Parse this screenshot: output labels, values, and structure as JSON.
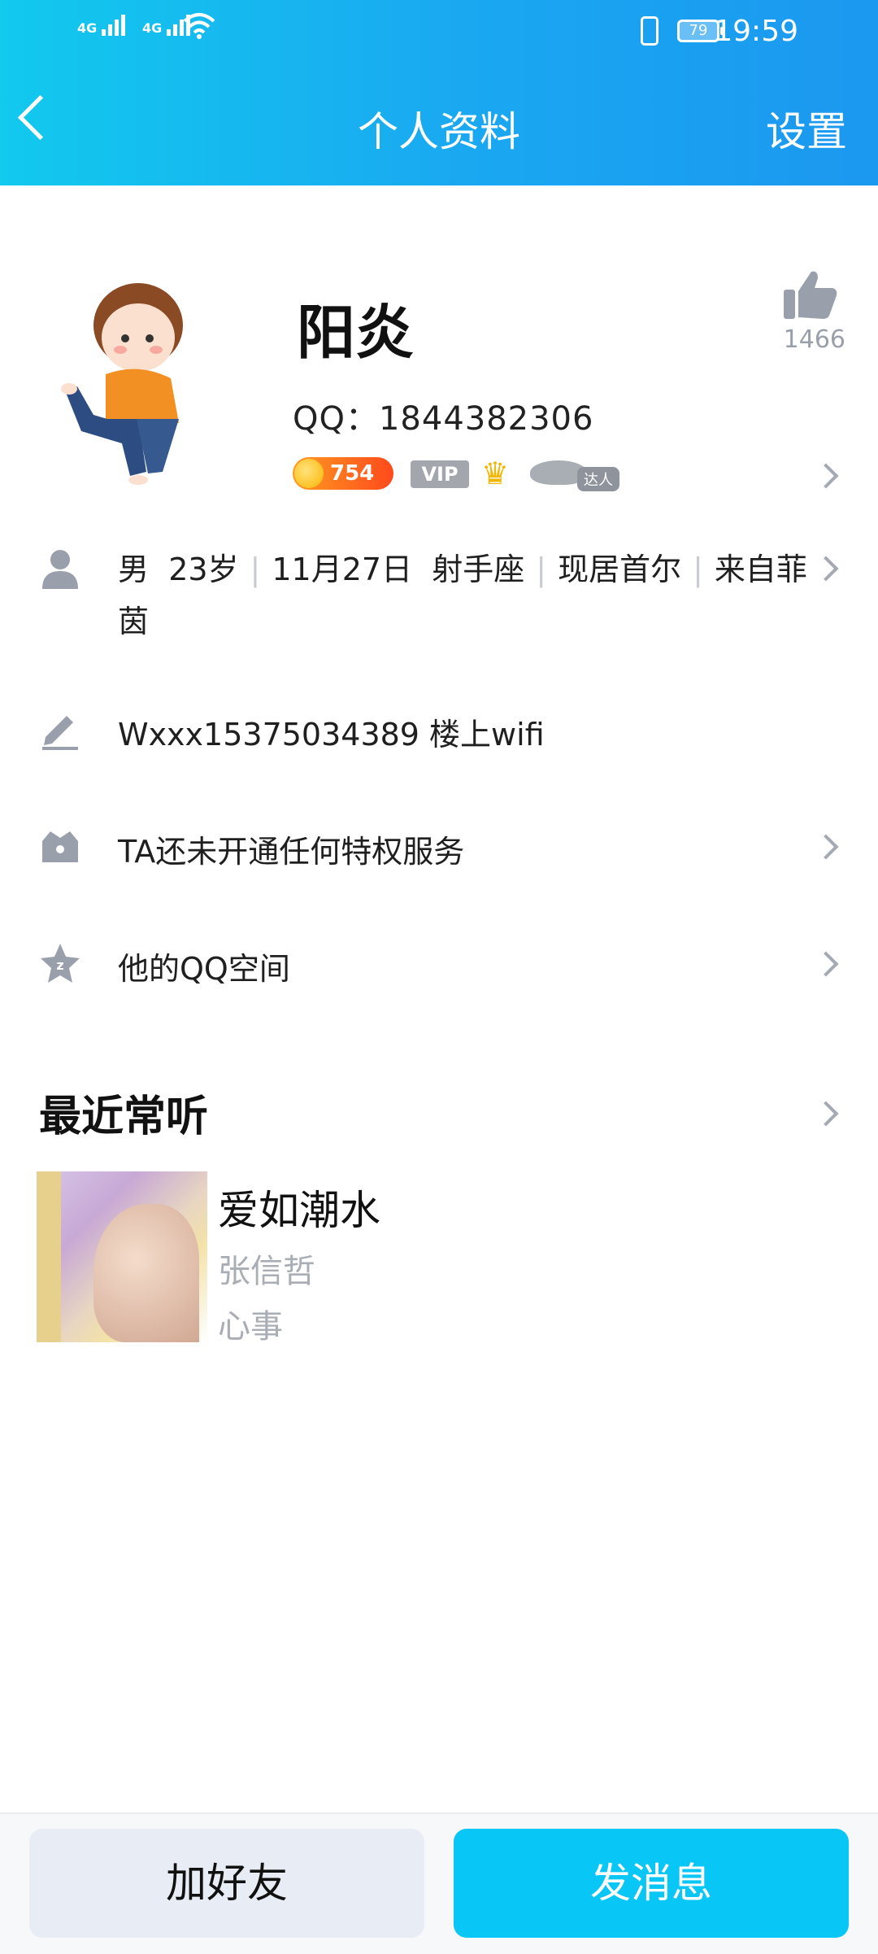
{
  "status_bar": {
    "net1": "4G",
    "net2": "4G",
    "battery": "79",
    "time": "19:59"
  },
  "header": {
    "back_icon": "chevron-left-icon",
    "title": "个人资料",
    "settings_label": "设置"
  },
  "profile": {
    "name": "阳炎",
    "qq": "QQ：1844382306",
    "likes": "1466",
    "coin_level": "754",
    "vip_label": "VIP",
    "daren_label": "达人"
  },
  "info": {
    "gender": "男",
    "age": "23岁",
    "birthday": "11月27日",
    "constellation": "射手座",
    "location": "现居首尔",
    "hometown": "来自菲茵"
  },
  "signature": "Wxxx15375034389 楼上wifi",
  "privilege": "TA还未开通任何特权服务",
  "qzone": "他的QQ空间",
  "recent_listen": {
    "title": "最近常听",
    "song": "爱如潮水",
    "artist": "张信哲",
    "album": "心事"
  },
  "buttons": {
    "add_friend": "加好友",
    "send_message": "发消息"
  },
  "colors": {
    "header_start": "#12c9ee",
    "header_end": "#1b98f0",
    "primary_button": "#08c6f6",
    "secondary_button": "#e8ecf4"
  }
}
